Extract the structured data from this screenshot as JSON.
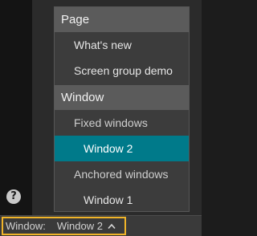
{
  "help": {
    "icon": "question-icon",
    "glyph": "?"
  },
  "menu": {
    "page_header": "Page",
    "page_items": [
      "What's new",
      "Screen group demo"
    ],
    "window_header": "Window",
    "fixed_header": "Fixed windows",
    "fixed_items": [
      "Window 2"
    ],
    "anchored_header": "Anchored windows",
    "anchored_items": [
      "Window 1"
    ],
    "selected": "Window 2",
    "selected_color": "#007a8a"
  },
  "status_bar": {
    "label": "Window:",
    "value": "Window 2",
    "icon": "chevron-up-icon",
    "highlight_color": "#f0b429"
  }
}
